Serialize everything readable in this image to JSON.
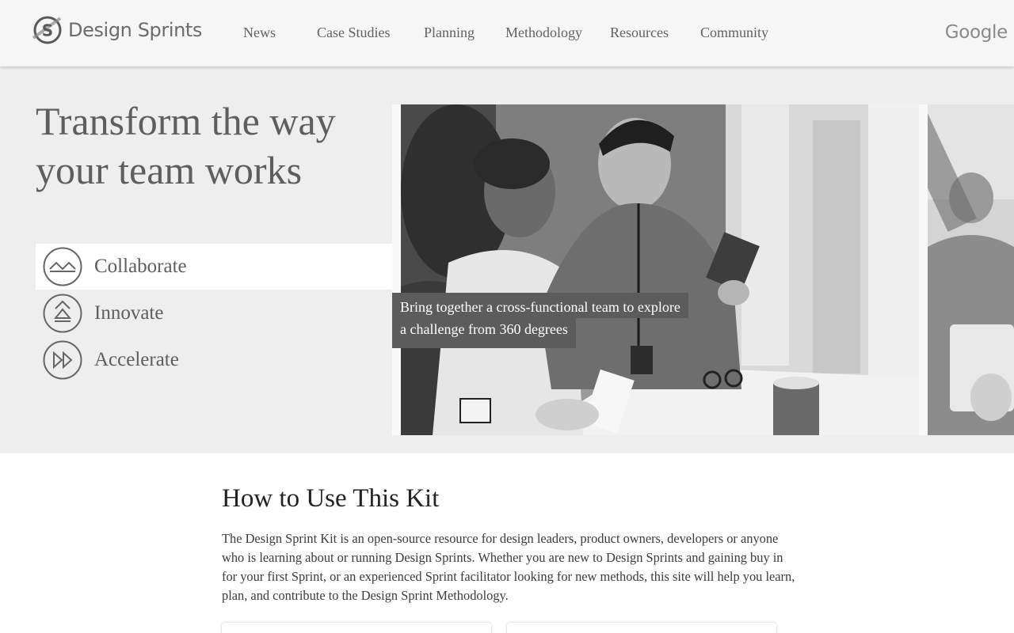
{
  "header": {
    "logo_text": "Design Sprints",
    "nav": [
      {
        "label": "News"
      },
      {
        "label": "Case Studies"
      },
      {
        "label": "Planning"
      },
      {
        "label": "Methodology"
      },
      {
        "label": "Resources"
      },
      {
        "label": "Community"
      }
    ],
    "brand": "Google"
  },
  "hero": {
    "title": "Transform the way your team works",
    "tabs": [
      {
        "label": "Collaborate",
        "icon": "mountains-icon",
        "active": true
      },
      {
        "label": "Innovate",
        "icon": "chevrons-up-icon",
        "active": false
      },
      {
        "label": "Accelerate",
        "icon": "fast-forward-icon",
        "active": false
      }
    ],
    "caption_line1": "Bring together a cross-functional team to explore",
    "caption_line2": "a challenge from 360 degrees"
  },
  "kit": {
    "title": "How to Use This Kit",
    "body": "The Design Sprint Kit is an open-source resource for design leaders, product owners, developers or anyone who is learning about or running Design Sprints. Whether you are new to Design Sprints and gaining buy in for your first Sprint, or an experienced Sprint facilitator looking for new methods, this site will help you learn, plan, and contribute to the Design Sprint Methodology."
  },
  "colors": {
    "header_bg": "#f6f6f6",
    "hero_bg": "#eeeeee",
    "caption_bg": "#5c5c5c",
    "text": "#3c3c3c"
  }
}
